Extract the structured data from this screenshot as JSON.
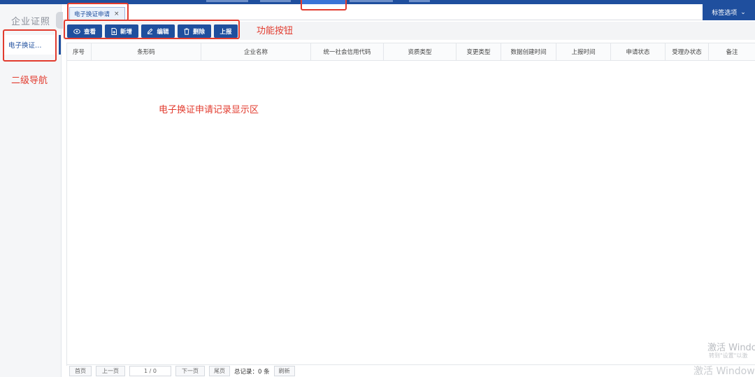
{
  "colors": {
    "primary": "#1f4f9e",
    "annotation": "#e23b2e"
  },
  "header": {
    "tag_options_label": "标签选项"
  },
  "sidebar": {
    "title": "企业证照",
    "items": [
      {
        "label": "电子换证…"
      }
    ]
  },
  "tabs": [
    {
      "label": "电子换证申请",
      "close": "×"
    }
  ],
  "toolbar": {
    "buttons": [
      {
        "label": "查看",
        "icon": "eye-icon"
      },
      {
        "label": "新增",
        "icon": "file-add-icon"
      },
      {
        "label": "编辑",
        "icon": "edit-icon"
      },
      {
        "label": "删除",
        "icon": "trash-icon"
      },
      {
        "label": "上报",
        "icon": ""
      }
    ]
  },
  "table": {
    "columns": [
      "序号",
      "条形码",
      "企业名称",
      "统一社会信用代码",
      "资质类型",
      "变更类型",
      "数据创建时间",
      "上报时间",
      "申请状态",
      "受理办状态",
      "备注"
    ]
  },
  "pager": {
    "first": "首页",
    "prev": "上一页",
    "page": "1 / 0",
    "next": "下一页",
    "last": "尾页",
    "total_label": "总记录：",
    "total_count": "0",
    "total_unit": "条",
    "refresh": "刷新"
  },
  "annotations": {
    "function_buttons": "功能按钮",
    "secondary_nav": "二级导航",
    "record_area": "电子换证申请记录显示区"
  },
  "watermark": {
    "line1": "激活 Windo",
    "line2": "转到\"设置\"以激",
    "line3": "激活 Windows"
  }
}
